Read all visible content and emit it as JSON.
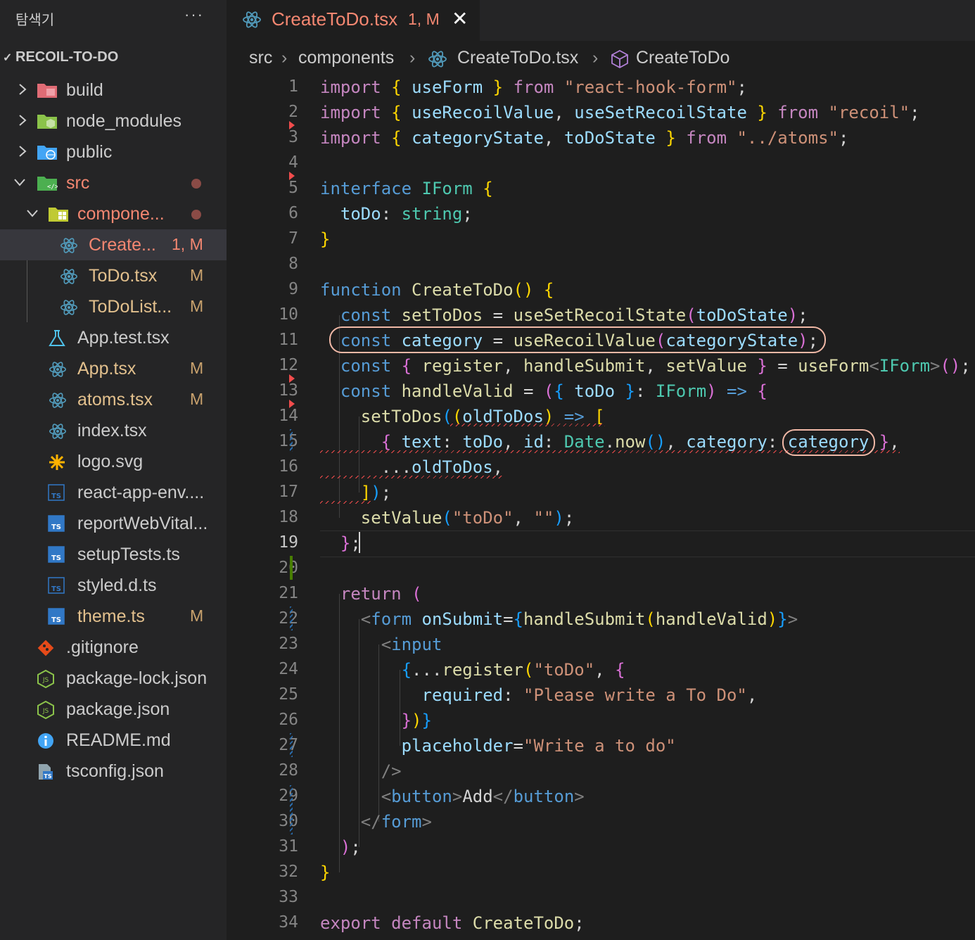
{
  "sidebar": {
    "title": "탐색기",
    "more_label": "···",
    "root_label": "RECOIL-TO-DO",
    "items": [
      {
        "name": "build",
        "icon": "build-folder-icon"
      },
      {
        "name": "node_modules",
        "icon": "node-folder-icon"
      },
      {
        "name": "public",
        "icon": "public-folder-icon"
      },
      {
        "name": "src",
        "icon": "src-folder-icon"
      },
      {
        "name": "compone...",
        "icon": "components-folder-icon"
      },
      {
        "name": "Create...",
        "badge": "1, M",
        "icon": "react-icon"
      },
      {
        "name": "ToDo.tsx",
        "badge": "M",
        "icon": "react-icon"
      },
      {
        "name": "ToDoList...",
        "badge": "M",
        "icon": "react-icon"
      },
      {
        "name": "App.test.tsx",
        "icon": "test-icon"
      },
      {
        "name": "App.tsx",
        "badge": "M",
        "icon": "react-icon"
      },
      {
        "name": "atoms.tsx",
        "badge": "M",
        "icon": "react-icon"
      },
      {
        "name": "index.tsx",
        "icon": "react-icon"
      },
      {
        "name": "logo.svg",
        "icon": "svg-icon"
      },
      {
        "name": "react-app-env....",
        "icon": "ts-def-icon"
      },
      {
        "name": "reportWebVital...",
        "icon": "ts-icon"
      },
      {
        "name": "setupTests.ts",
        "icon": "ts-icon"
      },
      {
        "name": "styled.d.ts",
        "icon": "ts-def-icon"
      },
      {
        "name": "theme.ts",
        "badge": "M",
        "icon": "ts-icon"
      },
      {
        "name": ".gitignore",
        "icon": "git-icon"
      },
      {
        "name": "package-lock.json",
        "icon": "node-json-icon"
      },
      {
        "name": "package.json",
        "icon": "node-json-icon"
      },
      {
        "name": "README.md",
        "icon": "info-icon"
      },
      {
        "name": "tsconfig.json",
        "icon": "tsconfig-icon"
      }
    ]
  },
  "tab": {
    "name": "CreateToDo.tsx",
    "badge": "1, M",
    "close": "✕"
  },
  "breadcrumb": {
    "part1": "src",
    "part2": "components",
    "part3": "CreateToDo.tsx",
    "part4": "CreateToDo",
    "sep": "›"
  },
  "editor": {
    "active_line": 19,
    "line_numbers": [
      "1",
      "2",
      "3",
      "4",
      "5",
      "6",
      "7",
      "8",
      "9",
      "10",
      "11",
      "12",
      "13",
      "14",
      "15",
      "16",
      "17",
      "18",
      "19",
      "20",
      "21",
      "22",
      "23",
      "24",
      "25",
      "26",
      "27",
      "28",
      "29",
      "30",
      "31",
      "32",
      "33",
      "34"
    ]
  },
  "colors": {
    "accent_error": "#f48771",
    "modified": "#e2c08d",
    "background": "#1e1e1e",
    "sidebar": "#252526"
  }
}
